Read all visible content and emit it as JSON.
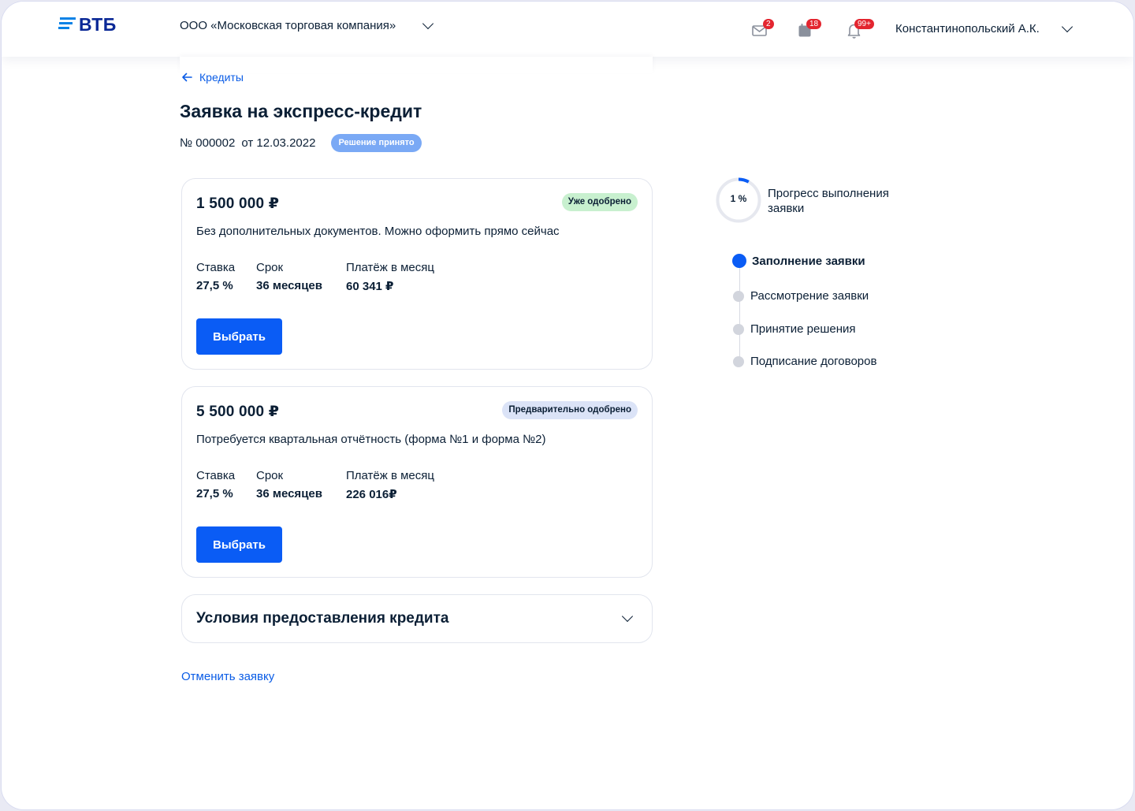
{
  "header": {
    "logo": "ВТБ",
    "company": "ООО «Московская торговая компания»",
    "badges": {
      "mail": "2",
      "calendar": "18",
      "notifications": "99+"
    },
    "user": "Константинопольский А.К."
  },
  "breadcrumb": {
    "label": "Кредиты"
  },
  "page": {
    "title": "Заявка на экспресс-кредит",
    "number": "№ 000002",
    "date": "от 12.03.2022",
    "status": "Решение принято"
  },
  "offers": [
    {
      "amount": "1 500 000 ₽",
      "tag": "Уже одобрено",
      "description": "Без дополнительных документов. Можно оформить прямо сейчас",
      "rate_label": "Ставка",
      "rate": "27,5 %",
      "term_label": "Срок",
      "term": "36 месяцев",
      "payment_label": "Платёж в месяц",
      "payment": "60 341 ₽",
      "button": "Выбрать"
    },
    {
      "amount": "5 500 000 ₽",
      "tag": "Предварительно одобрено",
      "description": "Потребуется квартальная отчётность (форма №1 и форма №2)",
      "rate_label": "Ставка",
      "rate": "27,5 %",
      "term_label": "Срок",
      "term": "36 месяцев",
      "payment_label": "Платёж в месяц",
      "payment": "226 016₽",
      "button": "Выбрать"
    }
  ],
  "accordion": {
    "title": "Условия предоставления кредита"
  },
  "cancel": "Отменить заявку",
  "progress": {
    "value_text": "1 %",
    "fraction": 0.01,
    "title": "Прогресс выполнения заявки",
    "steps": [
      {
        "label": "Заполнение заявки",
        "active": true
      },
      {
        "label": "Рассмотрение заявки",
        "active": false
      },
      {
        "label": "Принятие решения",
        "active": false
      },
      {
        "label": "Подписание договоров",
        "active": false
      }
    ]
  },
  "colors": {
    "accent": "#0a5cf5",
    "link": "#0a5ce6",
    "badge_red": "#e3252f",
    "tag_green": "#c8f0cf",
    "tag_blue": "#dbe3f7",
    "status_blue": "#7aa9f5"
  },
  "icons": [
    "arrow-left-icon",
    "mail-icon",
    "calendar-icon",
    "bell-icon",
    "chevron-down-icon"
  ]
}
